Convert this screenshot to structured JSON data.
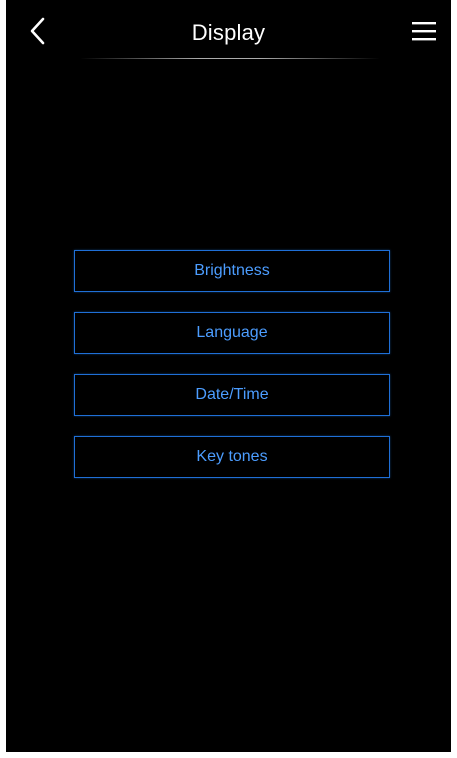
{
  "header": {
    "title": "Display",
    "back_icon": "chevron-left-icon",
    "menu_icon": "hamburger-menu-icon"
  },
  "menu": {
    "items": [
      {
        "label": "Brightness"
      },
      {
        "label": "Language"
      },
      {
        "label": "Date/Time"
      },
      {
        "label": "Key tones"
      }
    ]
  },
  "colors": {
    "background": "#000000",
    "accent_border": "#1f6fd6",
    "accent_text": "#4c9dff",
    "title_text": "#ffffff"
  }
}
